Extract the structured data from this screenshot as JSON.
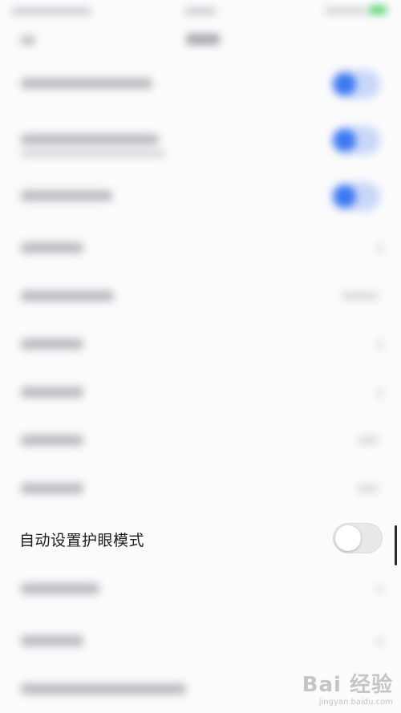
{
  "settings": {
    "eye_protection_auto": {
      "label": "自动设置护眼模式",
      "enabled": false
    }
  },
  "watermark": {
    "logo": "Bai 经验",
    "url": "jingyan.baidu.com"
  },
  "colors": {
    "accent": "#3d79f2",
    "toggle_off_track": "#e8e8ea",
    "background": "#fbfbfc",
    "battery": "#59d36f"
  }
}
